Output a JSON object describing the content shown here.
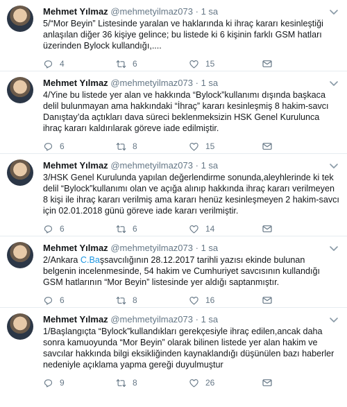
{
  "tweets": [
    {
      "name": "Mehmet Yılmaz",
      "handle": "@mehmetyilmaz073",
      "time": "1 sa",
      "text": "5/“Mor Beyin” Listesinde yaralan ve haklarında ki ihraç kararı kesinleştiği anlaşılan diğer 36 kişiye gelince; bu listede ki 6 kişinin farklı GSM hatları üzerinden Bylock kullandığı,....",
      "replies": "4",
      "retweets": "6",
      "likes": "15"
    },
    {
      "name": "Mehmet Yılmaz",
      "handle": "@mehmetyilmaz073",
      "time": "1 sa",
      "text": "4/Yine bu listede yer alan ve hakkında “Bylock”kullanımı dışında başkaca delil bulunmayan ama hakkındaki “İhraç” kararı kesinleşmiş 8 hakim-savcı Danıştay’da açtıkları dava süreci beklenmeksizin HSK Genel Kurulunca ihraç kararı kaldırılarak göreve iade edilmiştir.",
      "replies": "6",
      "retweets": "8",
      "likes": "15"
    },
    {
      "name": "Mehmet Yılmaz",
      "handle": "@mehmetyilmaz073",
      "time": "1 sa",
      "text": "3/HSK Genel Kurulunda yapılan değerlendirme sonunda,aleyhlerinde ki tek delil “Bylock”kullanımı olan ve açığa alınıp hakkında ihraç kararı verilmeyen 8 kişi ile ihraç kararı verilmiş ama kararı henüz kesinleşmeyen 2 hakim-savcı için 02.01.2018 günü göreve iade kararı verilmiştir.",
      "replies": "6",
      "retweets": "6",
      "likes": "14"
    },
    {
      "name": "Mehmet Yılmaz",
      "handle": "@mehmetyilmaz073",
      "time": "1 sa",
      "text_prefix": "2/Ankara ",
      "text_link": "C.Ba",
      "text": "şsavcılığının 28.12.2017 tarihli yazısı ekinde bulunan belgenin incelenmesinde, 54 hakim ve Cumhuriyet savcısının kullandığı GSM hatlarının “Mor Beyin” listesinde yer aldığı saptanmıştır.",
      "replies": "6",
      "retweets": "8",
      "likes": "16"
    },
    {
      "name": "Mehmet Yılmaz",
      "handle": "@mehmetyilmaz073",
      "time": "1 sa",
      "text": "1/Başlangıçta “Bylock”kullandıkları gerekçesiyle ihraç edilen,ancak daha sonra kamuoyunda “Mor Beyin” olarak bilinen listede yer alan hakim ve savcılar hakkında bilgi eksikliğinden kaynaklandığı düşünülen bazı haberler nedeniyle açıklama yapma gereği duyulmuştur",
      "replies": "9",
      "retweets": "8",
      "likes": "26"
    }
  ],
  "icons": {
    "reply": "reply-icon",
    "retweet": "retweet-icon",
    "like": "heart-icon",
    "dm": "mail-icon",
    "more": "chevron-down-icon"
  },
  "colors": {
    "text": "#14171a",
    "secondary": "#657786",
    "link": "#1b95e0",
    "divider": "#e6ecf0"
  }
}
